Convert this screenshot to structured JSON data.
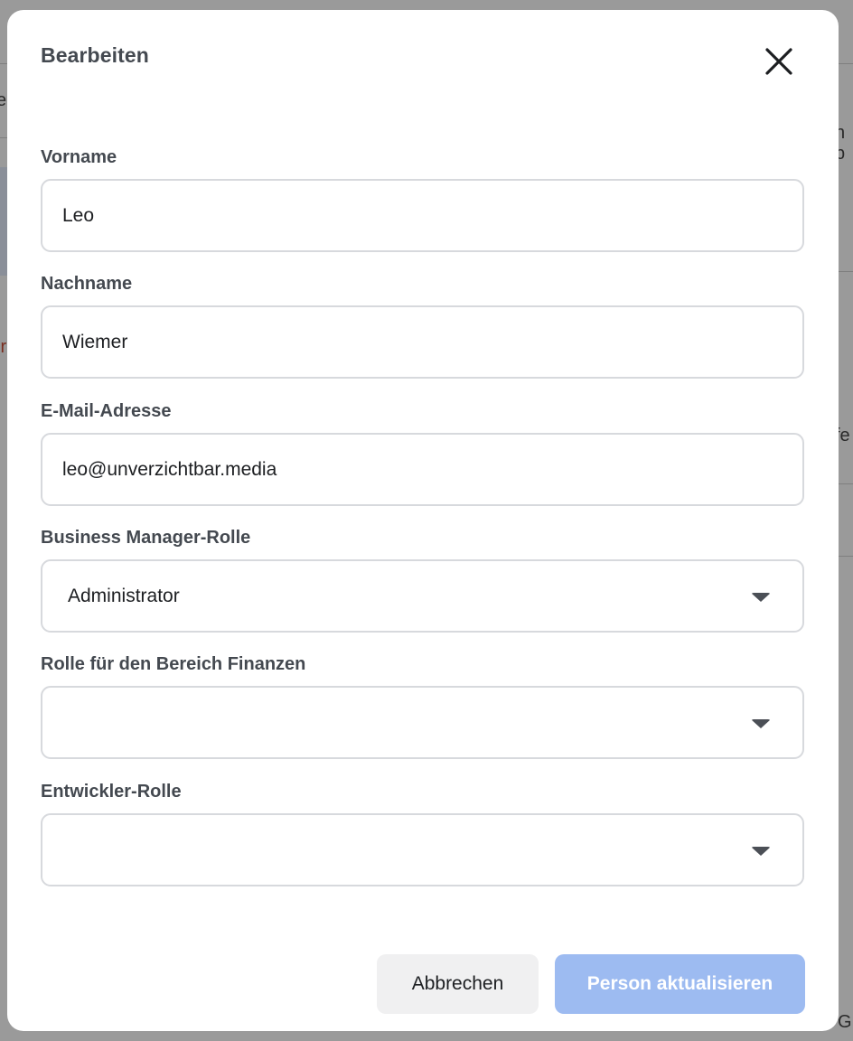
{
  "background": {
    "fragments": [
      "e",
      "n b",
      "ir",
      "fe",
      "G"
    ]
  },
  "dialog": {
    "title": "Bearbeiten",
    "close_icon": "close-icon"
  },
  "fields": {
    "first_name": {
      "label": "Vorname",
      "value": "Leo"
    },
    "last_name": {
      "label": "Nachname",
      "value": "Wiemer"
    },
    "email": {
      "label": "E-Mail-Adresse",
      "value": "leo@unverzichtbar.media"
    },
    "business_role": {
      "label": "Business Manager-Rolle",
      "value": "Administrator"
    },
    "finance_role": {
      "label": "Rolle für den Bereich Finanzen",
      "value": ""
    },
    "developer_role": {
      "label": "Entwickler-Rolle",
      "value": ""
    }
  },
  "actions": {
    "cancel_label": "Abbrechen",
    "submit_label": "Person aktualisieren"
  },
  "colors": {
    "primary_disabled": "#9dbbf1",
    "text_label": "#444950",
    "border": "#d7d9dd"
  }
}
